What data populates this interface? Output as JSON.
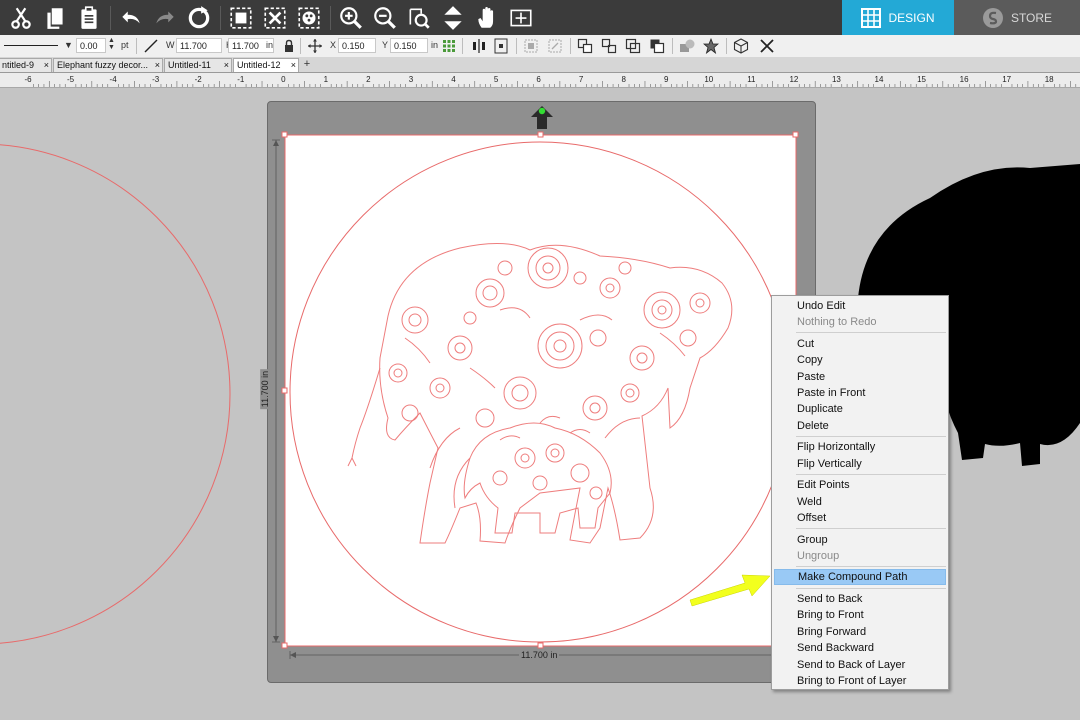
{
  "toolbar": {
    "design_label": "DESIGN",
    "store_label": "STORE",
    "accent_color": "#23a9d6"
  },
  "properties": {
    "line_width_value": "0.00",
    "line_width_unit": "pt",
    "w_label": "W",
    "width_value": "11.700",
    "h_label": "H",
    "height_value": "11.700",
    "size_unit": "in",
    "x_label": "X",
    "x_value": "0.150",
    "y_label": "Y",
    "y_value": "0.150",
    "position_unit": "in"
  },
  "doc_tabs": [
    {
      "label": "ntitled-9"
    },
    {
      "label": "Elephant fuzzy decor..."
    },
    {
      "label": "Untitled-11"
    },
    {
      "label": "Untitled-12"
    }
  ],
  "ruler": {
    "ticks": [
      "-6",
      "-5",
      "-4",
      "-3",
      "-2",
      "-1",
      "0",
      "1",
      "2",
      "3",
      "4",
      "5",
      "6",
      "7",
      "8",
      "9",
      "10",
      "11",
      "12",
      "13",
      "14",
      "15",
      "16",
      "17",
      "18"
    ]
  },
  "canvas": {
    "width_dimension": "11.700 in",
    "height_dimension": "11.700 in",
    "cut_line_color": "#f08080"
  },
  "context_menu": {
    "groups": [
      [
        {
          "label": "Undo Edit",
          "enabled": true
        },
        {
          "label": "Nothing to Redo",
          "enabled": false
        }
      ],
      [
        {
          "label": "Cut",
          "enabled": true
        },
        {
          "label": "Copy",
          "enabled": true
        },
        {
          "label": "Paste",
          "enabled": true
        },
        {
          "label": "Paste in Front",
          "enabled": true
        },
        {
          "label": "Duplicate",
          "enabled": true
        },
        {
          "label": "Delete",
          "enabled": true
        }
      ],
      [
        {
          "label": "Flip Horizontally",
          "enabled": true
        },
        {
          "label": "Flip Vertically",
          "enabled": true
        }
      ],
      [
        {
          "label": "Edit Points",
          "enabled": true
        },
        {
          "label": "Weld",
          "enabled": true
        },
        {
          "label": "Offset",
          "enabled": true
        }
      ],
      [
        {
          "label": "Group",
          "enabled": true
        },
        {
          "label": "Ungroup",
          "enabled": false
        }
      ],
      [
        {
          "label": "Make Compound Path",
          "enabled": true,
          "highlighted": true
        }
      ],
      [
        {
          "label": "Send to Back",
          "enabled": true
        },
        {
          "label": "Bring to Front",
          "enabled": true
        },
        {
          "label": "Bring Forward",
          "enabled": true
        },
        {
          "label": "Send Backward",
          "enabled": true
        },
        {
          "label": "Send to Back of Layer",
          "enabled": true
        },
        {
          "label": "Bring to Front of Layer",
          "enabled": true
        }
      ]
    ]
  },
  "annotation": {
    "arrow_color": "#f2ff1e"
  }
}
